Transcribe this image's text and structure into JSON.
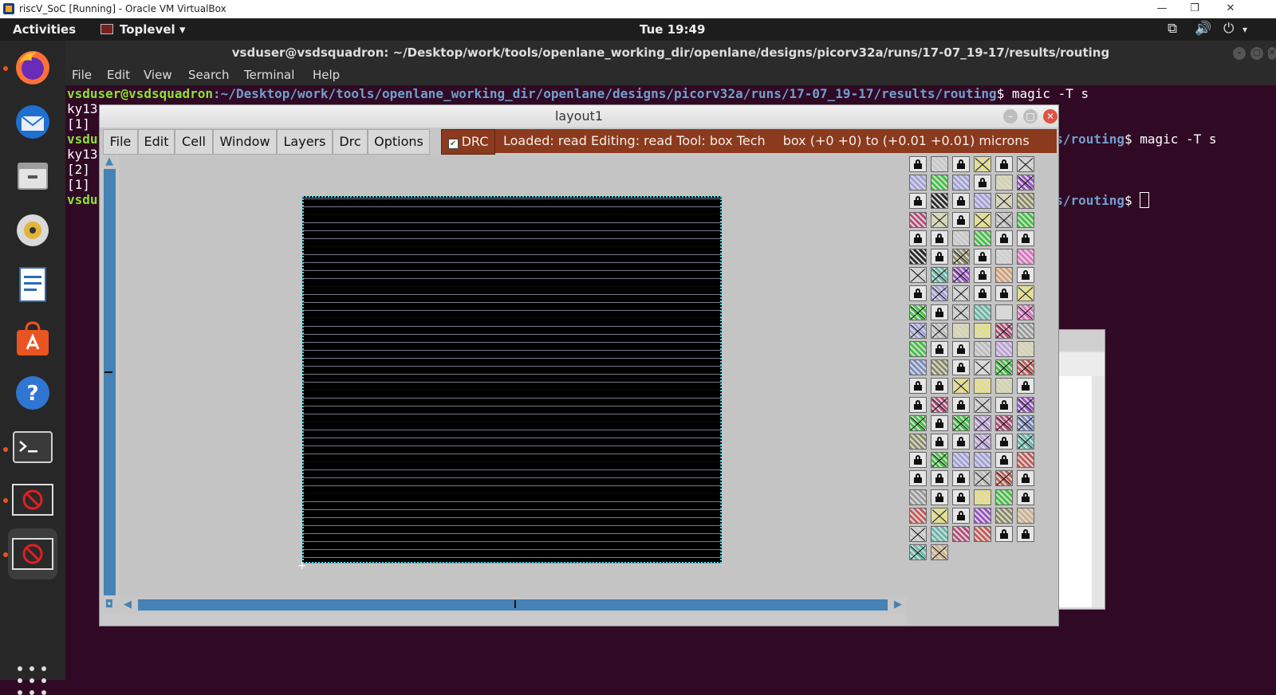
{
  "host_window": {
    "title": "riscV_SoC [Running] - Oracle VM VirtualBox",
    "minimize": "—",
    "restore": "❐",
    "close": "✕"
  },
  "topbar": {
    "activities": "Activities",
    "app_menu": "Toplevel",
    "clock": "Tue 19:49"
  },
  "dock": {
    "items": [
      "firefox-icon",
      "thunderbird-icon",
      "files-icon",
      "rhythmbox-icon",
      "writer-icon",
      "software-icon",
      "help-icon",
      "terminal-icon",
      "app-icon-1",
      "app-icon-2"
    ]
  },
  "terminal": {
    "title": "vsduser@vsdsquadron: ~/Desktop/work/tools/openlane_working_dir/openlane/designs/picorv32a/runs/17-07_19-17/results/routing",
    "menu": [
      "File",
      "Edit",
      "View",
      "Search",
      "Terminal",
      "Help"
    ],
    "user_host": "vsduser@vsdsquadron",
    "path": "~/Desktop/work/tools/openlane_working_dir/openlane/designs/picorv32a/runs/17-07_19-17/results/routing",
    "cmd_suffix": "$ magic -T s",
    "line2": "ky13",
    "line3": "[1]",
    "line4_user": "vsdu",
    "line4_path": "lts/routing",
    "line4_cmd": "$ magic -T s",
    "line5": "ky13",
    "line6": "[2]",
    "line7": "[1]",
    "line8_user": "vsdu",
    "line8_path": "lts/routing",
    "line8_cmd": "$ "
  },
  "layout_window": {
    "title": "layout1",
    "menu": [
      "File",
      "Edit",
      "Cell",
      "Window",
      "Layers",
      "Drc",
      "Options"
    ],
    "drc_label": "DRC",
    "status": "Loaded: read Editing: read Tool: box  Tech",
    "box_info": "box (+0 +0) to (+0.01 +0.01) microns"
  },
  "colors": {
    "terminal_bg": "#300a24",
    "prompt_user": "#8ae234",
    "prompt_path": "#729fcf",
    "status_bar": "#8b3a1e",
    "scrollbar": "#4682b4",
    "chip_boundary": "#33d6e6"
  }
}
